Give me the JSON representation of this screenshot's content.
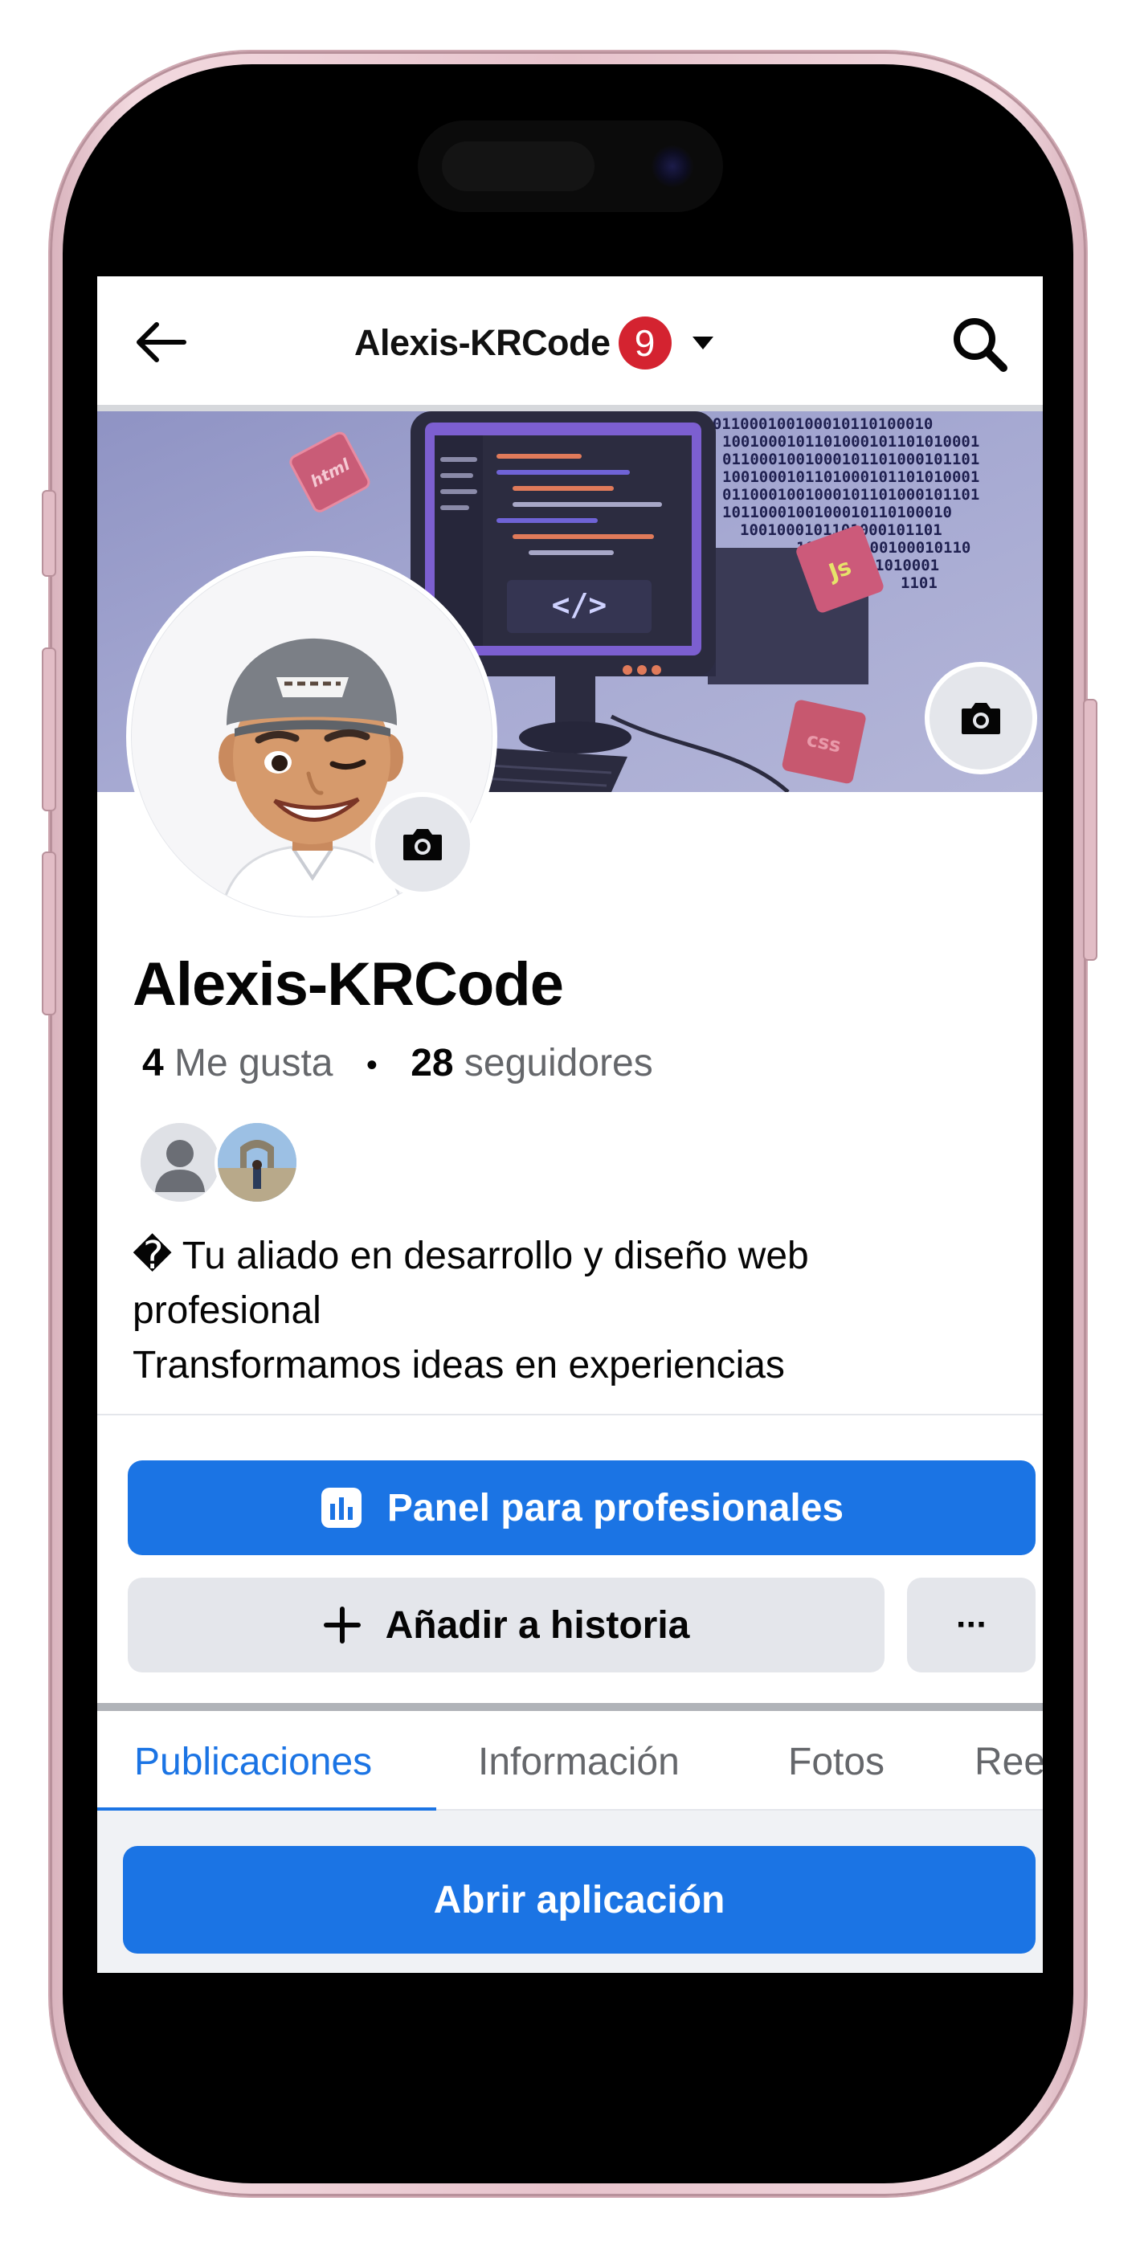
{
  "header": {
    "back_icon": "arrow-left-icon",
    "page_name": "Alexis-KRCode",
    "notification_count": "9",
    "switch_icon": "caret-down-icon",
    "search_icon": "search-icon"
  },
  "cover": {
    "image": "developer-workstation-illustration",
    "icons": [
      "html",
      "Js",
      "css"
    ],
    "code_symbol": "</>",
    "binary_rows": [
      "11000100101011000100100010110100010",
      "1001000101101000101101010001",
      "0110001001000101101000101101",
      "1011000100100010110100010",
      "1001000101101000101101",
      "1011000100100010110",
      "1010001",
      "1101"
    ],
    "camera_icon": "camera-icon"
  },
  "profile": {
    "avatar": "memoji-with-cap-avatar",
    "avatar_camera_icon": "camera-icon",
    "name": "Alexis-KRCode",
    "likes_count": "4",
    "likes_label": "Me gusta",
    "followers_count": "28",
    "followers_label": "seguidores",
    "separator": "•",
    "bio_lines": [
      "� Tu aliado en desarrollo y diseño web",
      "profesional",
      "Transformamos ideas en experiencias"
    ]
  },
  "actions": {
    "professional_panel": "Panel para profesionales",
    "add_story": "Añadir a historia",
    "more": "···",
    "open_app": "Abrir aplicación"
  },
  "tabs": [
    {
      "label": "Publicaciones",
      "active": true
    },
    {
      "label": "Información",
      "active": false
    },
    {
      "label": "Fotos",
      "active": false
    },
    {
      "label": "Reels",
      "active": false
    }
  ],
  "colors": {
    "accent": "#1b74e4",
    "badge": "#d42330",
    "secondary_button": "#e4e6eb",
    "phone_frame": "#e7c3cc"
  }
}
